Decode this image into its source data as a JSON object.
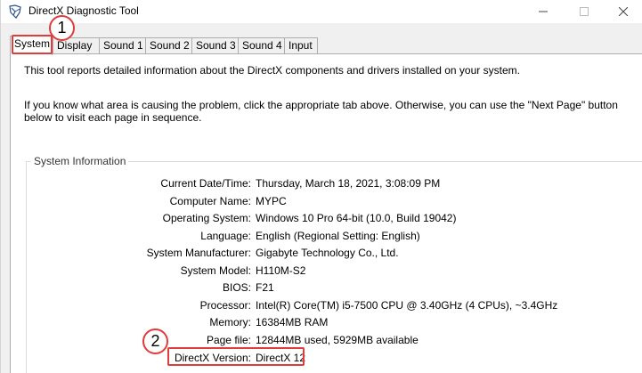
{
  "window": {
    "title": "DirectX Diagnostic Tool",
    "icons": {
      "app": "directx-app-icon",
      "minimize": "minimize-icon",
      "maximize": "maximize-icon",
      "close": "close-icon"
    }
  },
  "tabs": [
    {
      "label": "System",
      "active": true
    },
    {
      "label": "Display",
      "active": false
    },
    {
      "label": "Sound 1",
      "active": false
    },
    {
      "label": "Sound 2",
      "active": false
    },
    {
      "label": "Sound 3",
      "active": false
    },
    {
      "label": "Sound 4",
      "active": false
    },
    {
      "label": "Input",
      "active": false
    }
  ],
  "intro": {
    "line1": "This tool reports detailed information about the DirectX components and drivers installed on your system.",
    "line2": "If you know what area is causing the problem, click the appropriate tab above.  Otherwise, you can use the \"Next Page\" button below to visit each page in sequence."
  },
  "system_info": {
    "title": "System Information",
    "rows": [
      {
        "label": "Current Date/Time:",
        "value": "Thursday, March 18, 2021, 3:08:09 PM"
      },
      {
        "label": "Computer Name:",
        "value": "MYPC"
      },
      {
        "label": "Operating System:",
        "value": "Windows 10 Pro 64-bit (10.0, Build 19042)"
      },
      {
        "label": "Language:",
        "value": "English (Regional Setting: English)"
      },
      {
        "label": "System Manufacturer:",
        "value": "Gigabyte Technology Co., Ltd."
      },
      {
        "label": "System Model:",
        "value": "H110M-S2"
      },
      {
        "label": "BIOS:",
        "value": "F21"
      },
      {
        "label": "Processor:",
        "value": "Intel(R) Core(TM) i5-7500 CPU @ 3.40GHz (4 CPUs), ~3.4GHz"
      },
      {
        "label": "Memory:",
        "value": "16384MB RAM"
      },
      {
        "label": "Page file:",
        "value": "12844MB used, 5929MB available"
      },
      {
        "label": "DirectX Version:",
        "value": "DirectX 12"
      }
    ]
  },
  "annotations": {
    "step1": "1",
    "step2": "2",
    "highlight_color": "#e03c3c"
  }
}
